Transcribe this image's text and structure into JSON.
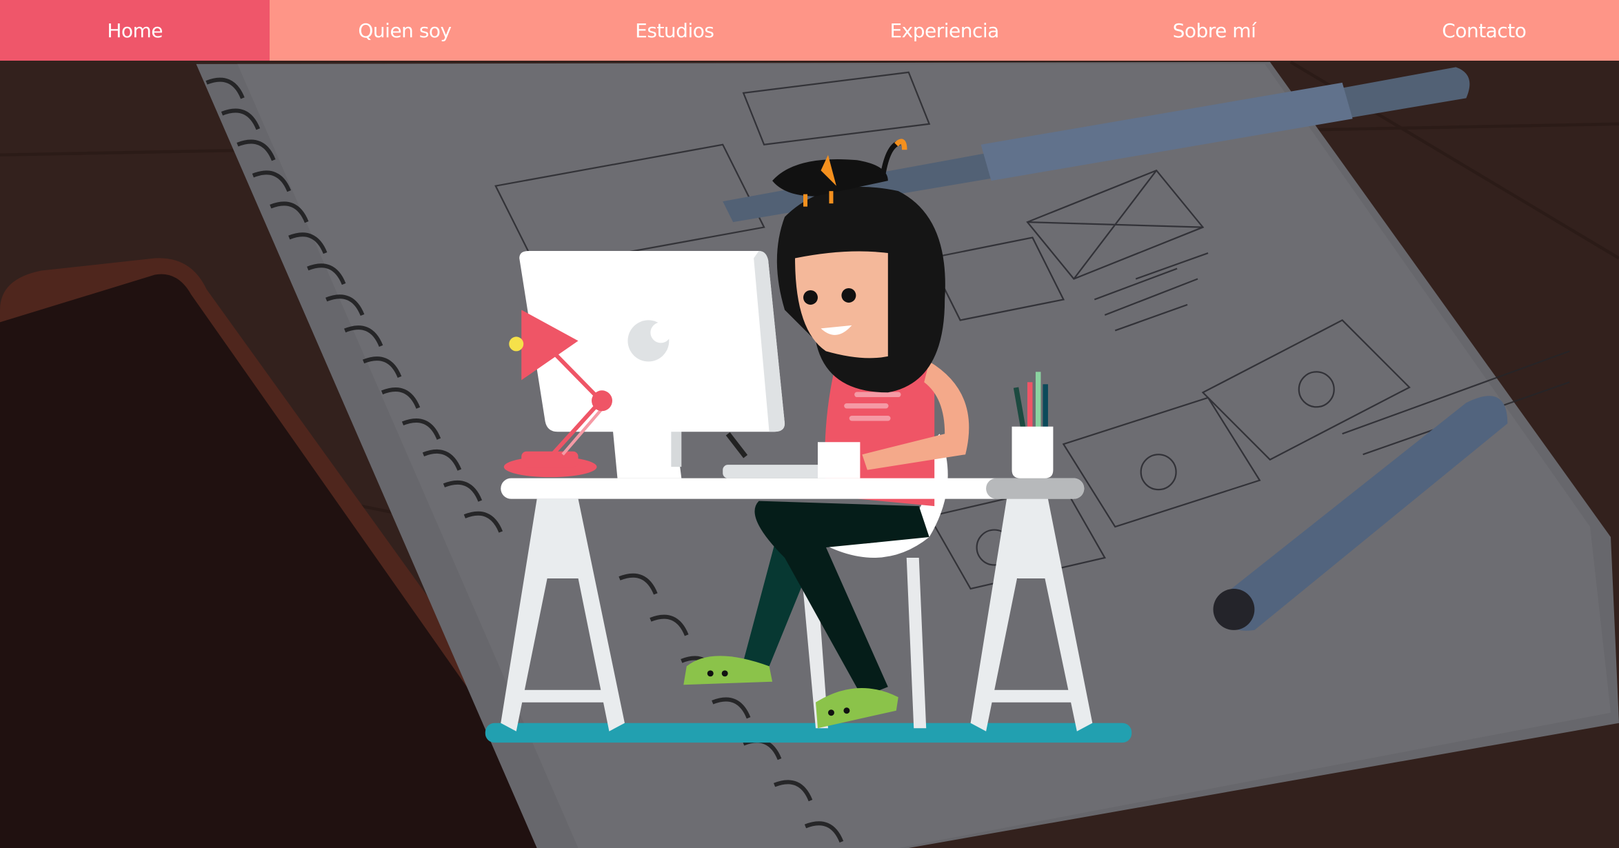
{
  "nav": {
    "items": [
      {
        "label": "Home",
        "active": true
      },
      {
        "label": "Quien soy",
        "active": false
      },
      {
        "label": "Estudios",
        "active": false
      },
      {
        "label": "Experiencia",
        "active": false
      },
      {
        "label": "Sobre mí",
        "active": false
      },
      {
        "label": "Contacto",
        "active": false
      }
    ]
  },
  "colors": {
    "nav_bg": "#fe9587",
    "nav_active": "#ef566a",
    "nav_text": "#ffffff"
  },
  "hero": {
    "background": "desk-with-wireframe-sketchbook-photo",
    "illustration": "girl-working-at-computer-desk"
  }
}
